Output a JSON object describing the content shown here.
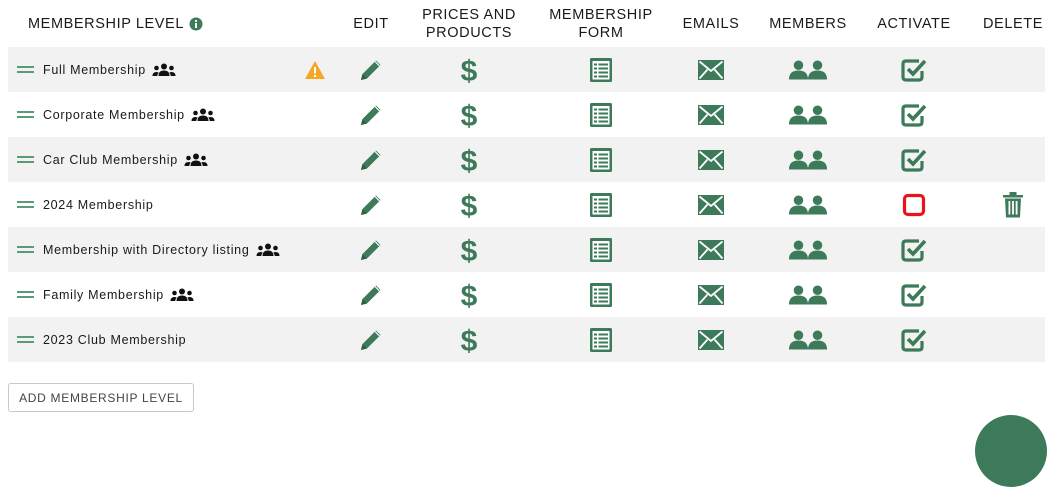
{
  "header": {
    "level": "MEMBERSHIP LEVEL",
    "edit": "EDIT",
    "prices": "PRICES AND PRODUCTS",
    "form": "MEMBERSHIP FORM",
    "emails": "EMAILS",
    "members": "MEMBERS",
    "activate": "ACTIVATE",
    "delete": "DELETE"
  },
  "rows": [
    {
      "name": "Full Membership",
      "group_icon": true,
      "warning": true,
      "active": true,
      "deletable": false
    },
    {
      "name": "Corporate Membership",
      "group_icon": true,
      "warning": false,
      "active": true,
      "deletable": false
    },
    {
      "name": "Car Club Membership",
      "group_icon": true,
      "warning": false,
      "active": true,
      "deletable": false
    },
    {
      "name": "2024 Membership",
      "group_icon": false,
      "warning": false,
      "active": false,
      "deletable": true
    },
    {
      "name": "Membership with Directory listing",
      "group_icon": true,
      "warning": false,
      "active": true,
      "deletable": false
    },
    {
      "name": "Family Membership",
      "group_icon": true,
      "warning": false,
      "active": true,
      "deletable": false
    },
    {
      "name": "2023 Club Membership",
      "group_icon": false,
      "warning": false,
      "active": true,
      "deletable": false
    }
  ],
  "actions": {
    "add_label": "ADD MEMBERSHIP LEVEL"
  },
  "colors": {
    "accent": "#3d7a5a",
    "warning": "#f5a623",
    "inactive": "#e8141c",
    "row_alt": "#f2f2f2"
  },
  "icons": [
    "drag-handle-icon",
    "group-icon",
    "warning-icon",
    "pencil-icon",
    "dollar-icon",
    "form-icon",
    "envelope-icon",
    "members-icon",
    "checkbox-checked-icon",
    "checkbox-empty-icon",
    "trash-icon",
    "info-icon"
  ]
}
